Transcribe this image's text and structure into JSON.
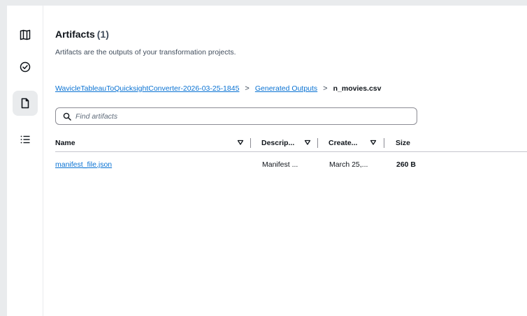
{
  "nav_rail": {
    "items": [
      {
        "icon": "book-icon",
        "active": false
      },
      {
        "icon": "check-circle-icon",
        "active": false
      },
      {
        "icon": "file-icon",
        "active": true
      },
      {
        "icon": "list-icon",
        "active": false
      }
    ]
  },
  "page": {
    "title": "Artifacts",
    "count": "(1)",
    "description": "Artifacts are the outputs of your transformation projects."
  },
  "breadcrumb": {
    "items": [
      {
        "label": "WavicleTableauToQuicksightConverter-2026-03-25-1845",
        "link": true
      },
      {
        "label": "Generated Outputs",
        "link": true
      },
      {
        "label": "n_movies.csv",
        "link": false
      }
    ],
    "separator": ">"
  },
  "search": {
    "placeholder": "Find artifacts",
    "value": ""
  },
  "table": {
    "columns": [
      {
        "label": "Name",
        "sortable": true
      },
      {
        "label": "Descrip...",
        "sortable": true
      },
      {
        "label": "Create...",
        "sortable": true
      },
      {
        "label": "Size",
        "sortable": false
      }
    ],
    "rows": [
      {
        "name": "manifest_file.json",
        "description": "Manifest ...",
        "created": "March 25,...",
        "size": "260 B"
      }
    ]
  },
  "colors": {
    "link": "#0972d3",
    "text": "#0f141a",
    "muted": "#414d5c",
    "border": "#c6c6cd",
    "active_bg": "#e9ebed"
  }
}
